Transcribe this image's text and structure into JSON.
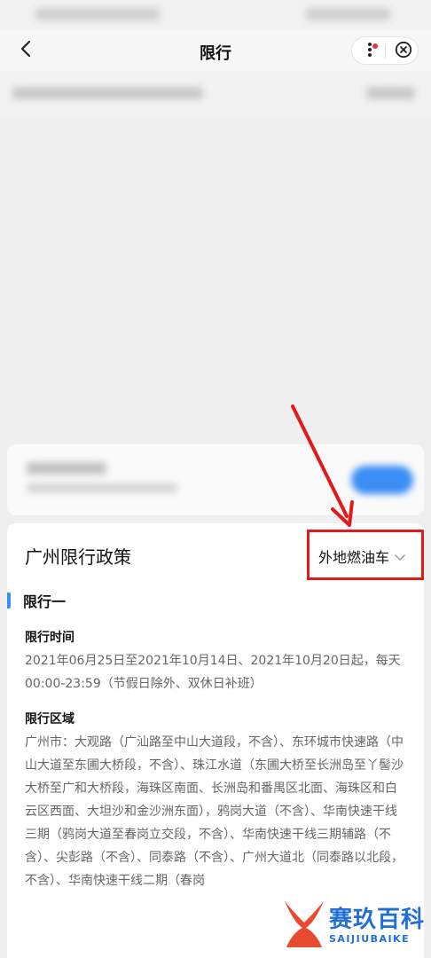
{
  "nav": {
    "title": "限行"
  },
  "policy": {
    "title": "广州限行政策",
    "vehicle_type": "外地燃油车",
    "section_title": "限行一",
    "time_heading": "限行时间",
    "time_text": "2021年06月25日至2021年10月14日、2021年10月20日起，每天00:00-23:59（节假日除外、双休日补班）",
    "area_heading": "限行区域",
    "area_text": "广州市：大观路（广汕路至中山大道段，不含）、东环城市快速路（中山大道至东圃大桥段，不含）、珠江水道（东圃大桥至长洲岛至丫髻沙大桥至广和大桥段，海珠区南面、长洲岛和番禺区北面、海珠区和白云区西面、大坦沙和金沙洲东面），鸦岗大道（不含）、华南快速干线三期（鸦岗大道至春岗立交段，不含）、华南快速干线三期辅路（不含）、尖彭路（不含）、同泰路（不含）、广州大道北（同泰路以北段，不含）、华南快速干线二期（春岗"
  },
  "watermark": {
    "title": "赛玖百科",
    "subtitle": "SAIJIUBAIKE"
  },
  "colors": {
    "accent": "#3a8ef6",
    "highlight": "#e11b1b",
    "watermark": "#1f6fd6"
  },
  "icons": {
    "back": "chevron-left-icon",
    "more": "more-vertical-icon",
    "close": "close-circle-icon",
    "dropdown": "chevron-down-icon"
  }
}
